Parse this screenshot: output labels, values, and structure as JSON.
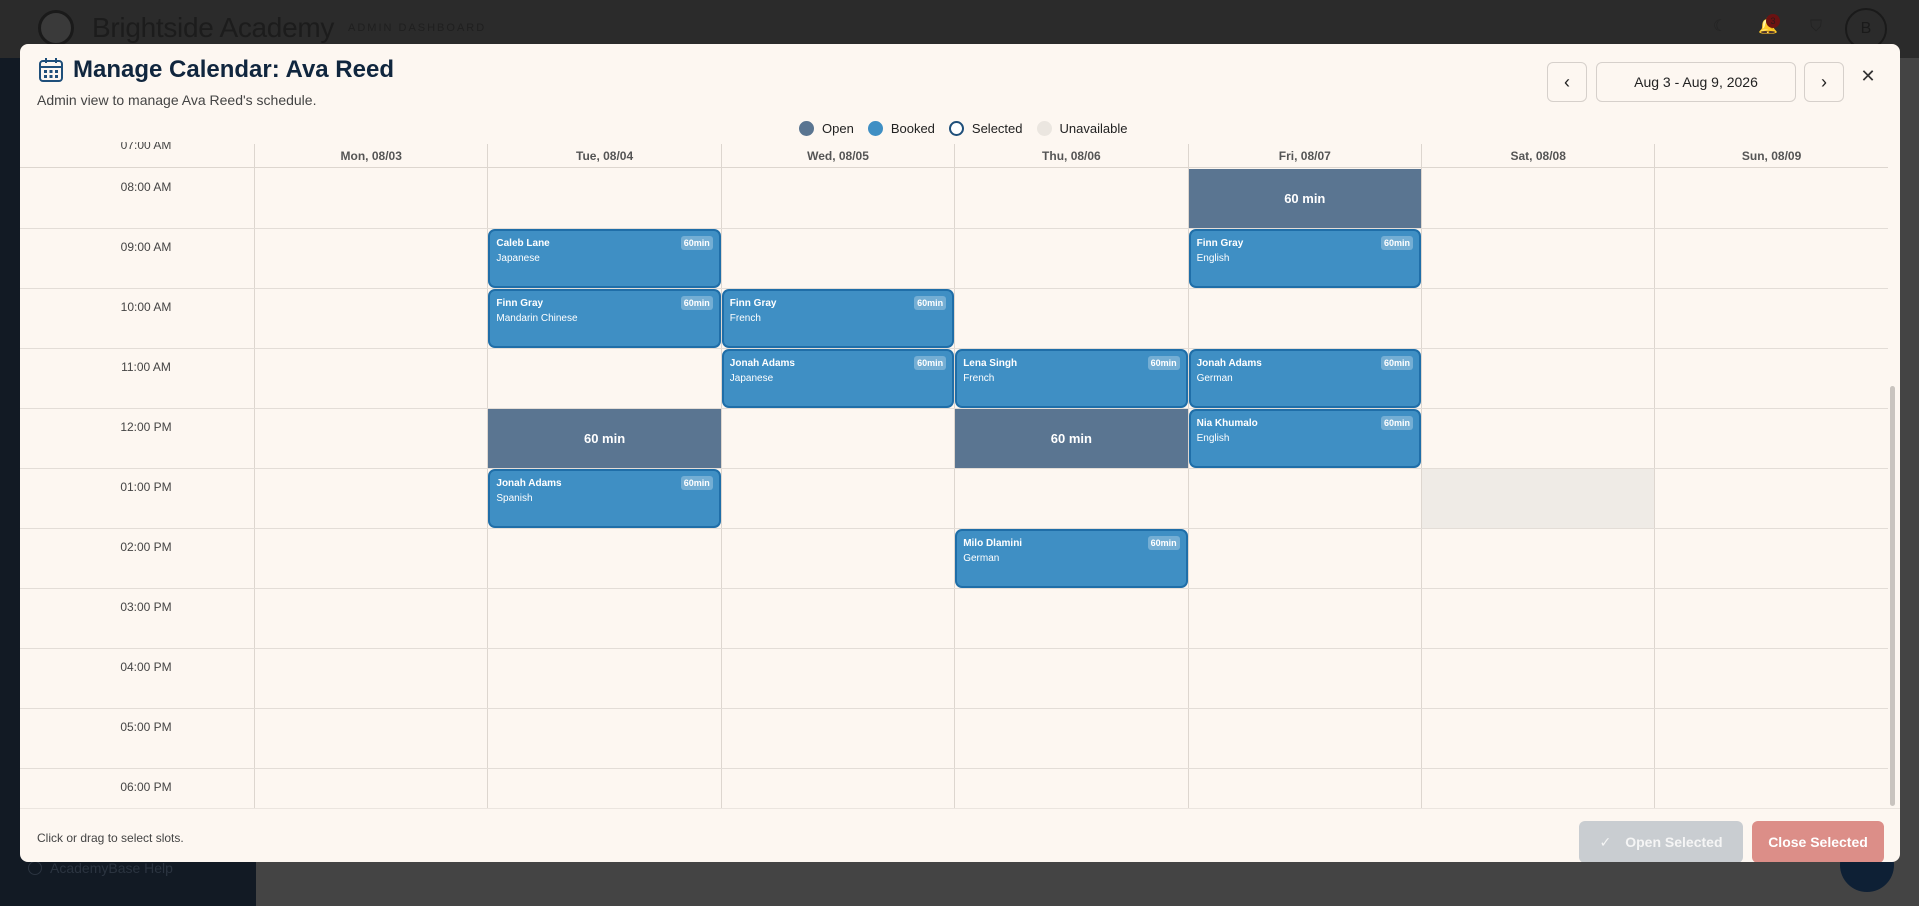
{
  "app": {
    "brand": "Brightside Academy",
    "subtitle": "ADMIN DASHBOARD",
    "notification_count": "3",
    "avatar_initial": "B",
    "help_link": "AcademyBase Help"
  },
  "modal": {
    "title": "Manage Calendar: Ava Reed",
    "subtitle": "Admin view to manage Ava Reed's schedule.",
    "date_range": "Aug 3 - Aug 9, 2026",
    "prev_icon": "chevron-left-icon",
    "next_icon": "chevron-right-icon",
    "close_icon": "close-icon"
  },
  "legend": [
    {
      "label": "Open",
      "color": "#5a7591"
    },
    {
      "label": "Booked",
      "color": "#3f8fc4"
    },
    {
      "label": "Selected",
      "color": "#ffffff"
    },
    {
      "label": "Unavailable",
      "color": "#ebe6e0"
    }
  ],
  "calendar": {
    "days": [
      "Mon, 08/03",
      "Tue, 08/04",
      "Wed, 08/05",
      "Thu, 08/06",
      "Fri, 08/07",
      "Sat, 08/08",
      "Sun, 08/09"
    ],
    "times": [
      "07:00 AM",
      "08:00 AM",
      "09:00 AM",
      "10:00 AM",
      "11:00 AM",
      "12:00 PM",
      "01:00 PM",
      "02:00 PM",
      "03:00 PM",
      "04:00 PM",
      "05:00 PM",
      "06:00 PM"
    ],
    "open_slots": [
      {
        "day": "Fri, 08/07",
        "time": "08:00 AM",
        "label": "60 min"
      },
      {
        "day": "Tue, 08/04",
        "time": "12:00 PM",
        "label": "60 min"
      },
      {
        "day": "Thu, 08/06",
        "time": "12:00 PM",
        "label": "60 min"
      }
    ],
    "booked_slots": [
      {
        "day": "Tue, 08/04",
        "time": "09:00 AM",
        "student": "Caleb Lane",
        "subject": "Japanese",
        "duration": "60min"
      },
      {
        "day": "Fri, 08/07",
        "time": "09:00 AM",
        "student": "Finn Gray",
        "subject": "English",
        "duration": "60min"
      },
      {
        "day": "Tue, 08/04",
        "time": "10:00 AM",
        "student": "Finn Gray",
        "subject": "Mandarin Chinese",
        "duration": "60min"
      },
      {
        "day": "Wed, 08/05",
        "time": "10:00 AM",
        "student": "Finn Gray",
        "subject": "French",
        "duration": "60min"
      },
      {
        "day": "Wed, 08/05",
        "time": "11:00 AM",
        "student": "Jonah Adams",
        "subject": "Japanese",
        "duration": "60min"
      },
      {
        "day": "Thu, 08/06",
        "time": "11:00 AM",
        "student": "Lena Singh",
        "subject": "French",
        "duration": "60min"
      },
      {
        "day": "Fri, 08/07",
        "time": "11:00 AM",
        "student": "Jonah Adams",
        "subject": "German",
        "duration": "60min"
      },
      {
        "day": "Fri, 08/07",
        "time": "12:00 PM",
        "student": "Nia Khumalo",
        "subject": "English",
        "duration": "60min"
      },
      {
        "day": "Tue, 08/04",
        "time": "01:00 PM",
        "student": "Jonah Adams",
        "subject": "Spanish",
        "duration": "60min"
      },
      {
        "day": "Thu, 08/06",
        "time": "02:00 PM",
        "student": "Milo Dlamini",
        "subject": "German",
        "duration": "60min"
      }
    ],
    "unavailable_slots": [
      {
        "day": "Sat, 08/08",
        "time": "01:00 PM"
      }
    ]
  },
  "footer": {
    "hint": "Click or drag to select slots.",
    "open_selected": "Open Selected",
    "close_selected": "Close Selected",
    "check_icon": "check-icon"
  }
}
